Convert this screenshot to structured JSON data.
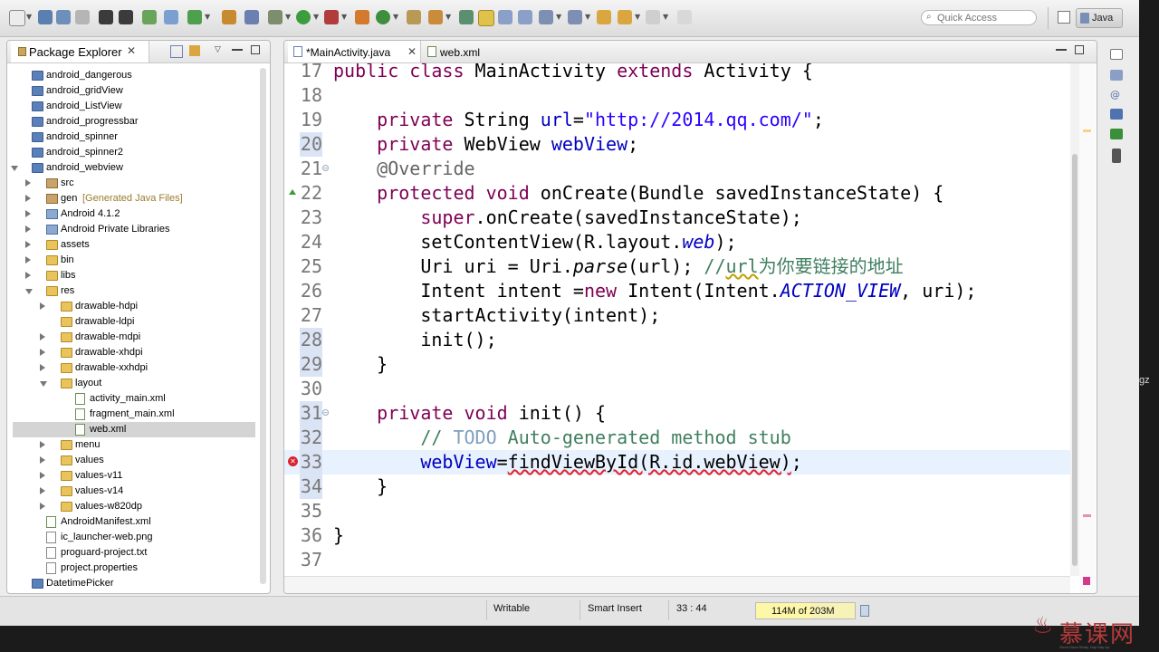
{
  "toolbar": {
    "quick_access_placeholder": "Quick Access",
    "perspective_label": "Java"
  },
  "package_explorer": {
    "title": "Package Explorer",
    "tree": [
      {
        "label": "android_dangerous",
        "icon": "project-icon",
        "depth": 0,
        "twisty": "none"
      },
      {
        "label": "android_gridView",
        "icon": "project-icon",
        "depth": 0,
        "twisty": "none"
      },
      {
        "label": "android_ListView",
        "icon": "project-icon",
        "depth": 0,
        "twisty": "none"
      },
      {
        "label": "android_progressbar",
        "icon": "project-icon",
        "depth": 0,
        "twisty": "none"
      },
      {
        "label": "android_spinner",
        "icon": "project-icon",
        "depth": 0,
        "twisty": "none"
      },
      {
        "label": "android_spinner2",
        "icon": "project-icon",
        "depth": 0,
        "twisty": "none"
      },
      {
        "label": "android_webview",
        "icon": "project-icon",
        "depth": 0,
        "twisty": "open"
      },
      {
        "label": "src",
        "icon": "package-folder-icon",
        "depth": 1,
        "twisty": "closed"
      },
      {
        "label": "gen",
        "decoration": "[Generated Java Files]",
        "icon": "package-folder-icon",
        "depth": 1,
        "twisty": "closed"
      },
      {
        "label": "Android 4.1.2",
        "icon": "library-icon",
        "depth": 1,
        "twisty": "closed"
      },
      {
        "label": "Android Private Libraries",
        "icon": "library-icon",
        "depth": 1,
        "twisty": "closed"
      },
      {
        "label": "assets",
        "icon": "folder-icon",
        "depth": 1,
        "twisty": "closed"
      },
      {
        "label": "bin",
        "icon": "folder-icon",
        "depth": 1,
        "twisty": "closed"
      },
      {
        "label": "libs",
        "icon": "folder-icon",
        "depth": 1,
        "twisty": "closed"
      },
      {
        "label": "res",
        "icon": "folder-icon",
        "depth": 1,
        "twisty": "open"
      },
      {
        "label": "drawable-hdpi",
        "icon": "folder-icon",
        "depth": 2,
        "twisty": "closed"
      },
      {
        "label": "drawable-ldpi",
        "icon": "folder-icon",
        "depth": 2,
        "twisty": "none"
      },
      {
        "label": "drawable-mdpi",
        "icon": "folder-icon",
        "depth": 2,
        "twisty": "closed"
      },
      {
        "label": "drawable-xhdpi",
        "icon": "folder-icon",
        "depth": 2,
        "twisty": "closed"
      },
      {
        "label": "drawable-xxhdpi",
        "icon": "folder-icon",
        "depth": 2,
        "twisty": "closed"
      },
      {
        "label": "layout",
        "icon": "folder-icon",
        "depth": 2,
        "twisty": "open"
      },
      {
        "label": "activity_main.xml",
        "icon": "xml-file-icon",
        "depth": 3,
        "twisty": "none"
      },
      {
        "label": "fragment_main.xml",
        "icon": "xml-file-icon",
        "depth": 3,
        "twisty": "none"
      },
      {
        "label": "web.xml",
        "icon": "xml-file-icon",
        "depth": 3,
        "twisty": "none",
        "selected": true
      },
      {
        "label": "menu",
        "icon": "folder-icon",
        "depth": 2,
        "twisty": "closed"
      },
      {
        "label": "values",
        "icon": "folder-icon",
        "depth": 2,
        "twisty": "closed"
      },
      {
        "label": "values-v11",
        "icon": "folder-icon",
        "depth": 2,
        "twisty": "closed"
      },
      {
        "label": "values-v14",
        "icon": "folder-icon",
        "depth": 2,
        "twisty": "closed"
      },
      {
        "label": "values-w820dp",
        "icon": "folder-icon",
        "depth": 2,
        "twisty": "closed"
      },
      {
        "label": "AndroidManifest.xml",
        "icon": "xml-file-icon",
        "depth": 1,
        "twisty": "none"
      },
      {
        "label": "ic_launcher-web.png",
        "icon": "file-icon",
        "depth": 1,
        "twisty": "none"
      },
      {
        "label": "proguard-project.txt",
        "icon": "file-icon",
        "depth": 1,
        "twisty": "none"
      },
      {
        "label": "project.properties",
        "icon": "file-icon",
        "depth": 1,
        "twisty": "none"
      },
      {
        "label": "DatetimePicker",
        "icon": "project-icon",
        "depth": 0,
        "twisty": "none"
      }
    ]
  },
  "editor": {
    "tabs": [
      {
        "label": "*MainActivity.java",
        "active": true
      },
      {
        "label": "web.xml",
        "active": false
      }
    ],
    "lines": [
      {
        "num": "17",
        "segs": [
          [
            "kw",
            "public class "
          ],
          [
            "",
            "MainActivity "
          ],
          [
            "kw",
            "extends "
          ],
          [
            "",
            "Activity {"
          ]
        ]
      },
      {
        "num": "18",
        "segs": []
      },
      {
        "num": "19",
        "segs": [
          [
            "",
            "    "
          ],
          [
            "kw",
            "private "
          ],
          [
            "",
            "String "
          ],
          [
            "fld",
            "url"
          ],
          [
            "",
            "="
          ],
          [
            "str",
            "\"http://2014.qq.com/\""
          ],
          [
            "",
            ";"
          ]
        ]
      },
      {
        "num": "20",
        "hl": true,
        "segs": [
          [
            "",
            "    "
          ],
          [
            "kw",
            "private "
          ],
          [
            "",
            "WebView "
          ],
          [
            "fld",
            "webView"
          ],
          [
            "",
            ";"
          ]
        ]
      },
      {
        "num": "21",
        "fold": true,
        "segs": [
          [
            "",
            "    "
          ],
          [
            "ann",
            "@Override"
          ]
        ]
      },
      {
        "num": "22",
        "override": true,
        "segs": [
          [
            "",
            "    "
          ],
          [
            "kw",
            "protected void "
          ],
          [
            "",
            "onCreate(Bundle savedInstanceState) {"
          ]
        ]
      },
      {
        "num": "23",
        "segs": [
          [
            "",
            "        "
          ],
          [
            "kw",
            "super"
          ],
          [
            "",
            ".onCreate(savedInstanceState);"
          ]
        ]
      },
      {
        "num": "24",
        "segs": [
          [
            "",
            "        setContentView(R.layout."
          ],
          [
            "cst",
            "web"
          ],
          [
            "",
            ");"
          ]
        ]
      },
      {
        "num": "25",
        "segs": [
          [
            "",
            "        Uri uri = Uri."
          ],
          [
            "ital",
            "parse"
          ],
          [
            "",
            "(url); "
          ],
          [
            "cmt",
            "//"
          ],
          [
            "cmt warn",
            "url"
          ],
          [
            "cmt",
            "为你要链接的地址"
          ]
        ]
      },
      {
        "num": "26",
        "segs": [
          [
            "",
            "        Intent intent ="
          ],
          [
            "kw",
            "new "
          ],
          [
            "",
            "Intent(Intent."
          ],
          [
            "cst",
            "ACTION_VIEW"
          ],
          [
            "",
            ", uri);"
          ]
        ]
      },
      {
        "num": "27",
        "segs": [
          [
            "",
            "        startActivity(intent);"
          ]
        ]
      },
      {
        "num": "28",
        "hl": true,
        "segs": [
          [
            "",
            "        init();"
          ]
        ]
      },
      {
        "num": "29",
        "hl": true,
        "segs": [
          [
            "",
            "    }"
          ]
        ]
      },
      {
        "num": "30",
        "segs": []
      },
      {
        "num": "31",
        "hl": true,
        "fold": true,
        "segs": [
          [
            "",
            "    "
          ],
          [
            "kw",
            "private void "
          ],
          [
            "",
            "init() {"
          ]
        ]
      },
      {
        "num": "32",
        "hl": true,
        "segs": [
          [
            "",
            "        "
          ],
          [
            "cmt",
            "// "
          ],
          [
            "todo",
            "TODO"
          ],
          [
            "cmt",
            " Auto-generated method stub"
          ]
        ]
      },
      {
        "num": "33",
        "hl": true,
        "error": true,
        "current": true,
        "segs": [
          [
            "",
            "        "
          ],
          [
            "fld",
            "webView"
          ],
          [
            "",
            "="
          ],
          [
            "err",
            "findViewById(R.id.webView)"
          ],
          [
            "",
            ";"
          ]
        ]
      },
      {
        "num": "34",
        "hl": true,
        "segs": [
          [
            "",
            "    }"
          ]
        ]
      },
      {
        "num": "35",
        "segs": []
      },
      {
        "num": "36",
        "segs": [
          [
            "",
            "}"
          ]
        ]
      },
      {
        "num": "37",
        "segs": []
      }
    ]
  },
  "status": {
    "writable": "Writable",
    "insert_mode": "Smart Insert",
    "cursor_position": "33 : 44",
    "heap_used": "114M of 203M",
    "heap_fraction": 0.56
  },
  "side_fragment": "gz",
  "logo": {
    "brand": "慕课网",
    "tagline": "Good Good Study, Day Day Up"
  },
  "colors": {
    "keyword": "#7f0055",
    "string": "#2a00ff",
    "field": "#0000c0",
    "comment": "#3f7f5f",
    "annotation": "#646464",
    "current_line": "#e8f2fe",
    "error": "#d9232f"
  }
}
